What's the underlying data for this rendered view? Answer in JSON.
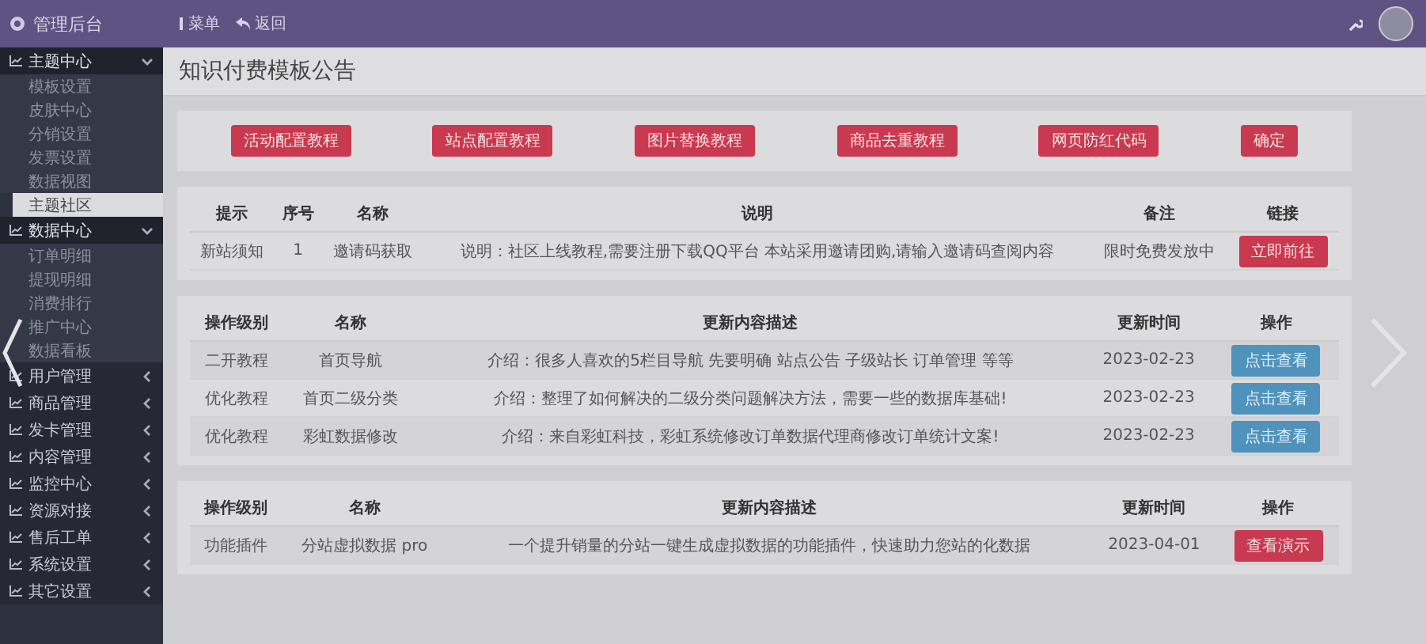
{
  "topbar": {
    "title": "管理后台",
    "links": [
      {
        "label": "菜单"
      },
      {
        "label": "返回"
      }
    ]
  },
  "sidebar": {
    "groups": [
      {
        "label": "主题中心",
        "expanded": true,
        "children": [
          {
            "label": "模板设置",
            "selected": false
          },
          {
            "label": "皮肤中心",
            "selected": false
          },
          {
            "label": "分销设置",
            "selected": false
          },
          {
            "label": "发票设置",
            "selected": false
          },
          {
            "label": "数据视图",
            "selected": false
          },
          {
            "label": "主题社区",
            "selected": true
          }
        ]
      },
      {
        "label": "数据中心",
        "expanded": true,
        "children": [
          {
            "label": "订单明细",
            "selected": false
          },
          {
            "label": "提现明细",
            "selected": false
          },
          {
            "label": "消费排行",
            "selected": false
          },
          {
            "label": "推广中心",
            "selected": false
          },
          {
            "label": "数据看板",
            "selected": false
          }
        ]
      },
      {
        "label": "用户管理",
        "expanded": false
      },
      {
        "label": "商品管理",
        "expanded": false
      },
      {
        "label": "发卡管理",
        "expanded": false
      },
      {
        "label": "内容管理",
        "expanded": false
      },
      {
        "label": "监控中心",
        "expanded": false
      },
      {
        "label": "资源对接",
        "expanded": false
      },
      {
        "label": "售后工单",
        "expanded": false
      },
      {
        "label": "系统设置",
        "expanded": false
      },
      {
        "label": "其它设置",
        "expanded": false
      }
    ]
  },
  "page_title": "知识付费模板公告",
  "tutorial_buttons": [
    "活动配置教程",
    "站点配置教程",
    "图片替换教程",
    "商品去重教程",
    "网页防红代码",
    "确定"
  ],
  "notice_table": {
    "columns": [
      "提示",
      "序号",
      "名称",
      "说明",
      "备注",
      "链接"
    ],
    "rows": [
      {
        "cells": [
          "新站须知",
          "1",
          "邀请码获取",
          "说明：社区上线教程,需要注册下载QQ平台 本站采用邀请团购,请输入邀请码查阅内容",
          "限时免费发放中"
        ],
        "action": {
          "label": "立即前往",
          "kind": "danger"
        }
      }
    ]
  },
  "update_tables": [
    {
      "columns": [
        "操作级别",
        "名称",
        "更新内容描述",
        "更新时间",
        "操作"
      ],
      "rows": [
        {
          "cells": [
            "二开教程",
            "首页导航",
            "介绍：很多人喜欢的5栏目导航 先要明确 站点公告 子级站长 订单管理 等等",
            "2023-02-23"
          ],
          "action": {
            "label": "点击查看",
            "kind": "info"
          }
        },
        {
          "cells": [
            "优化教程",
            "首页二级分类",
            "介绍：整理了如何解决的二级分类问题解决方法，需要一些的数据库基础!",
            "2023-02-23"
          ],
          "action": {
            "label": "点击查看",
            "kind": "info"
          }
        },
        {
          "cells": [
            "优化教程",
            "彩虹数据修改",
            "介绍：来自彩虹科技，彩虹系统修改订单数据代理商修改订单统计文案!",
            "2023-02-23"
          ],
          "action": {
            "label": "点击查看",
            "kind": "info"
          }
        }
      ]
    },
    {
      "columns": [
        "操作级别",
        "名称",
        "更新内容描述",
        "更新时间",
        "操作"
      ],
      "rows": [
        {
          "cells": [
            "功能插件",
            "分站虚拟数据 pro",
            "一个提升销量的分站一键生成虚拟数据的功能插件，快速助力您站的化数据",
            "2023-04-01"
          ],
          "action": {
            "label": "查看演示",
            "kind": "danger"
          }
        }
      ]
    }
  ]
}
